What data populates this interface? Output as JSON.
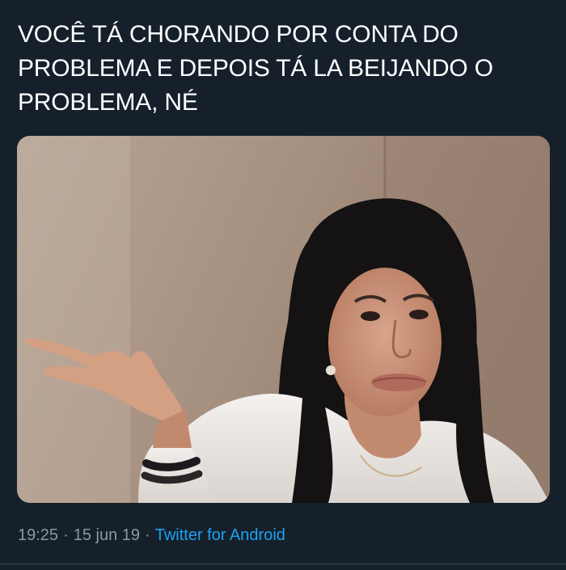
{
  "tweet": {
    "text": "VOCÊ TÁ CHORANDO POR CONTA DO PROBLEMA E DEPOIS TÁ LA BEIJANDO O PROBLEMA, NÉ",
    "time": "19:25",
    "date": "15 jun 19",
    "source": "Twitter for Android",
    "separator": "·"
  },
  "colors": {
    "background": "#15202b",
    "text": "#ffffff",
    "secondary_text": "#8899a6",
    "link": "#1da1f2",
    "divider": "#38444d"
  }
}
